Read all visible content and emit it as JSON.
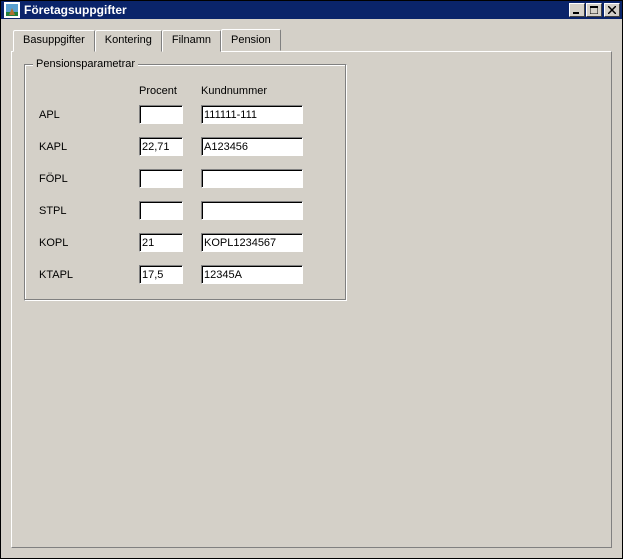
{
  "window": {
    "title": "Företagsuppgifter"
  },
  "tabs": {
    "t0": "Basuppgifter",
    "t1": "Kontering",
    "t2": "Filnamn",
    "t3": "Pension"
  },
  "group": {
    "legend": "Pensionsparametrar",
    "header_procent": "Procent",
    "header_kund": "Kundnummer"
  },
  "rows": {
    "apl": {
      "label": "APL",
      "procent": "",
      "kund": "111111-111"
    },
    "kapl": {
      "label": "KAPL",
      "procent": "22,71",
      "kund": "A123456"
    },
    "fopl": {
      "label": "FÖPL",
      "procent": "",
      "kund": ""
    },
    "stpl": {
      "label": "STPL",
      "procent": "",
      "kund": ""
    },
    "kopl": {
      "label": "KOPL",
      "procent": "21",
      "kund": "KOPL1234567"
    },
    "ktapl": {
      "label": "KTAPL",
      "procent": "17,5",
      "kund": "12345A"
    }
  }
}
